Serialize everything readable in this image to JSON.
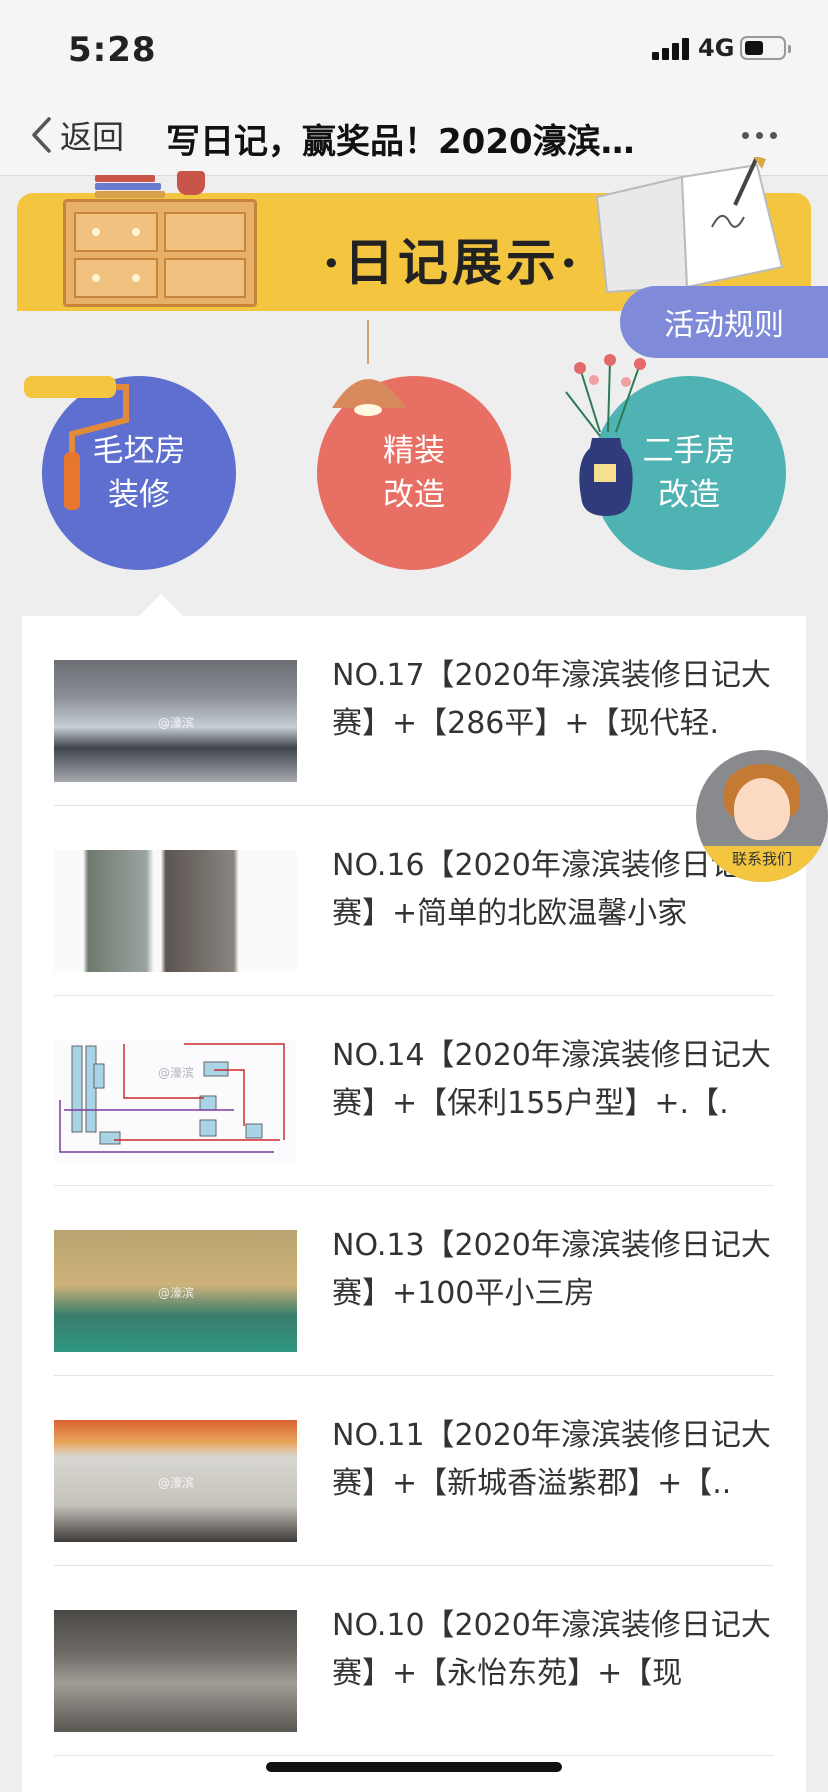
{
  "status_bar": {
    "time": "5:28",
    "network": "4G"
  },
  "navbar": {
    "back_label": "返回",
    "title": "写日记，赢奖品！2020濠滨…"
  },
  "banner": {
    "title": "·日记展示·",
    "rules_button": "活动规则"
  },
  "categories": [
    {
      "label_line1": "毛坯房",
      "label_line2": "装修"
    },
    {
      "label_line1": "精装",
      "label_line2": "改造"
    },
    {
      "label_line1": "二手房",
      "label_line2": "改造"
    }
  ],
  "diary_items": [
    {
      "text": "NO.17【2020年濠滨装修日记大赛】+【286平】+【现代轻.",
      "watermark": "@濠滨"
    },
    {
      "text": "NO.16【2020年濠滨装修日记大赛】+简单的北欧温馨小家",
      "watermark": ""
    },
    {
      "text": "NO.14【2020年濠滨装修日记大赛】+【保利155户型】+.【.",
      "watermark": "@濠滨"
    },
    {
      "text": "NO.13【2020年濠滨装修日记大赛】+100平小三房",
      "watermark": "@濠滨"
    },
    {
      "text": "NO.11【2020年濠滨装修日记大赛】+【新城香溢紫郡】+【..",
      "watermark": "@濠滨"
    },
    {
      "text": "NO.10【2020年濠滨装修日记大赛】+【永怡东苑】+【现",
      "watermark": ""
    }
  ],
  "contact": {
    "label": "联系我们"
  },
  "colors": {
    "banner": "#f4c640",
    "blue": "#5e6fd0",
    "red": "#e86f63",
    "teal": "#4fb3b4",
    "rules": "#7f8ad8"
  }
}
